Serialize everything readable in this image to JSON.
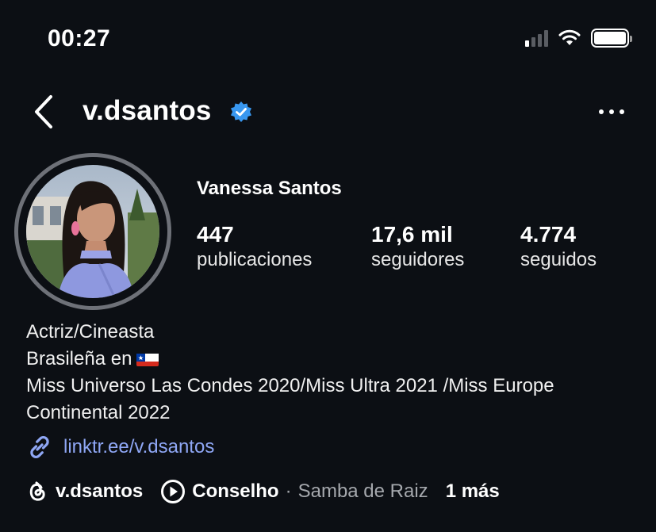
{
  "status_bar": {
    "time": "00:27",
    "signal_icon": "cellular-signal-icon",
    "wifi_icon": "wifi-icon",
    "battery_icon": "battery-icon"
  },
  "header": {
    "username": "v.dsantos",
    "verified_icon": "verified-badge-icon",
    "back_icon": "chevron-left-icon",
    "more_icon": "more-horizontal-icon"
  },
  "profile": {
    "full_name": "Vanessa Santos",
    "stats": [
      {
        "value": "447",
        "label": "publicaciones"
      },
      {
        "value": "17,6 mil",
        "label": "seguidores"
      },
      {
        "value": "4.774",
        "label": "seguidos"
      }
    ]
  },
  "bio": {
    "line1": "Actriz/Cineasta",
    "line2": "Brasileña en",
    "line2_flag": "chile-flag-icon",
    "line3": "Miss Universo Las Condes 2020/Miss Ultra 2021 /Miss Europe Continental 2022"
  },
  "link": {
    "icon": "link-icon",
    "text": "linktr.ee/v.dsantos",
    "color": "#8fa7f5"
  },
  "footer": {
    "threads_icon": "threads-icon",
    "threads_name": "v.dsantos",
    "play_icon": "play-circle-icon",
    "song": "Conselho",
    "separator": "·",
    "artist": "Samba de Raiz",
    "more": "1 más"
  }
}
